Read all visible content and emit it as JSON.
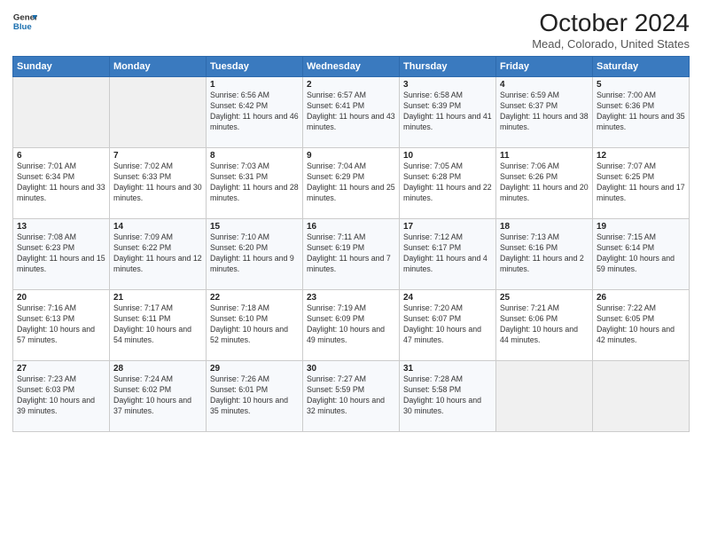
{
  "header": {
    "logo_line1": "General",
    "logo_line2": "Blue",
    "title": "October 2024",
    "subtitle": "Mead, Colorado, United States"
  },
  "weekdays": [
    "Sunday",
    "Monday",
    "Tuesday",
    "Wednesday",
    "Thursday",
    "Friday",
    "Saturday"
  ],
  "weeks": [
    [
      {
        "day": "",
        "info": ""
      },
      {
        "day": "",
        "info": ""
      },
      {
        "day": "1",
        "info": "Sunrise: 6:56 AM\nSunset: 6:42 PM\nDaylight: 11 hours and 46 minutes."
      },
      {
        "day": "2",
        "info": "Sunrise: 6:57 AM\nSunset: 6:41 PM\nDaylight: 11 hours and 43 minutes."
      },
      {
        "day": "3",
        "info": "Sunrise: 6:58 AM\nSunset: 6:39 PM\nDaylight: 11 hours and 41 minutes."
      },
      {
        "day": "4",
        "info": "Sunrise: 6:59 AM\nSunset: 6:37 PM\nDaylight: 11 hours and 38 minutes."
      },
      {
        "day": "5",
        "info": "Sunrise: 7:00 AM\nSunset: 6:36 PM\nDaylight: 11 hours and 35 minutes."
      }
    ],
    [
      {
        "day": "6",
        "info": "Sunrise: 7:01 AM\nSunset: 6:34 PM\nDaylight: 11 hours and 33 minutes."
      },
      {
        "day": "7",
        "info": "Sunrise: 7:02 AM\nSunset: 6:33 PM\nDaylight: 11 hours and 30 minutes."
      },
      {
        "day": "8",
        "info": "Sunrise: 7:03 AM\nSunset: 6:31 PM\nDaylight: 11 hours and 28 minutes."
      },
      {
        "day": "9",
        "info": "Sunrise: 7:04 AM\nSunset: 6:29 PM\nDaylight: 11 hours and 25 minutes."
      },
      {
        "day": "10",
        "info": "Sunrise: 7:05 AM\nSunset: 6:28 PM\nDaylight: 11 hours and 22 minutes."
      },
      {
        "day": "11",
        "info": "Sunrise: 7:06 AM\nSunset: 6:26 PM\nDaylight: 11 hours and 20 minutes."
      },
      {
        "day": "12",
        "info": "Sunrise: 7:07 AM\nSunset: 6:25 PM\nDaylight: 11 hours and 17 minutes."
      }
    ],
    [
      {
        "day": "13",
        "info": "Sunrise: 7:08 AM\nSunset: 6:23 PM\nDaylight: 11 hours and 15 minutes."
      },
      {
        "day": "14",
        "info": "Sunrise: 7:09 AM\nSunset: 6:22 PM\nDaylight: 11 hours and 12 minutes."
      },
      {
        "day": "15",
        "info": "Sunrise: 7:10 AM\nSunset: 6:20 PM\nDaylight: 11 hours and 9 minutes."
      },
      {
        "day": "16",
        "info": "Sunrise: 7:11 AM\nSunset: 6:19 PM\nDaylight: 11 hours and 7 minutes."
      },
      {
        "day": "17",
        "info": "Sunrise: 7:12 AM\nSunset: 6:17 PM\nDaylight: 11 hours and 4 minutes."
      },
      {
        "day": "18",
        "info": "Sunrise: 7:13 AM\nSunset: 6:16 PM\nDaylight: 11 hours and 2 minutes."
      },
      {
        "day": "19",
        "info": "Sunrise: 7:15 AM\nSunset: 6:14 PM\nDaylight: 10 hours and 59 minutes."
      }
    ],
    [
      {
        "day": "20",
        "info": "Sunrise: 7:16 AM\nSunset: 6:13 PM\nDaylight: 10 hours and 57 minutes."
      },
      {
        "day": "21",
        "info": "Sunrise: 7:17 AM\nSunset: 6:11 PM\nDaylight: 10 hours and 54 minutes."
      },
      {
        "day": "22",
        "info": "Sunrise: 7:18 AM\nSunset: 6:10 PM\nDaylight: 10 hours and 52 minutes."
      },
      {
        "day": "23",
        "info": "Sunrise: 7:19 AM\nSunset: 6:09 PM\nDaylight: 10 hours and 49 minutes."
      },
      {
        "day": "24",
        "info": "Sunrise: 7:20 AM\nSunset: 6:07 PM\nDaylight: 10 hours and 47 minutes."
      },
      {
        "day": "25",
        "info": "Sunrise: 7:21 AM\nSunset: 6:06 PM\nDaylight: 10 hours and 44 minutes."
      },
      {
        "day": "26",
        "info": "Sunrise: 7:22 AM\nSunset: 6:05 PM\nDaylight: 10 hours and 42 minutes."
      }
    ],
    [
      {
        "day": "27",
        "info": "Sunrise: 7:23 AM\nSunset: 6:03 PM\nDaylight: 10 hours and 39 minutes."
      },
      {
        "day": "28",
        "info": "Sunrise: 7:24 AM\nSunset: 6:02 PM\nDaylight: 10 hours and 37 minutes."
      },
      {
        "day": "29",
        "info": "Sunrise: 7:26 AM\nSunset: 6:01 PM\nDaylight: 10 hours and 35 minutes."
      },
      {
        "day": "30",
        "info": "Sunrise: 7:27 AM\nSunset: 5:59 PM\nDaylight: 10 hours and 32 minutes."
      },
      {
        "day": "31",
        "info": "Sunrise: 7:28 AM\nSunset: 5:58 PM\nDaylight: 10 hours and 30 minutes."
      },
      {
        "day": "",
        "info": ""
      },
      {
        "day": "",
        "info": ""
      }
    ]
  ]
}
